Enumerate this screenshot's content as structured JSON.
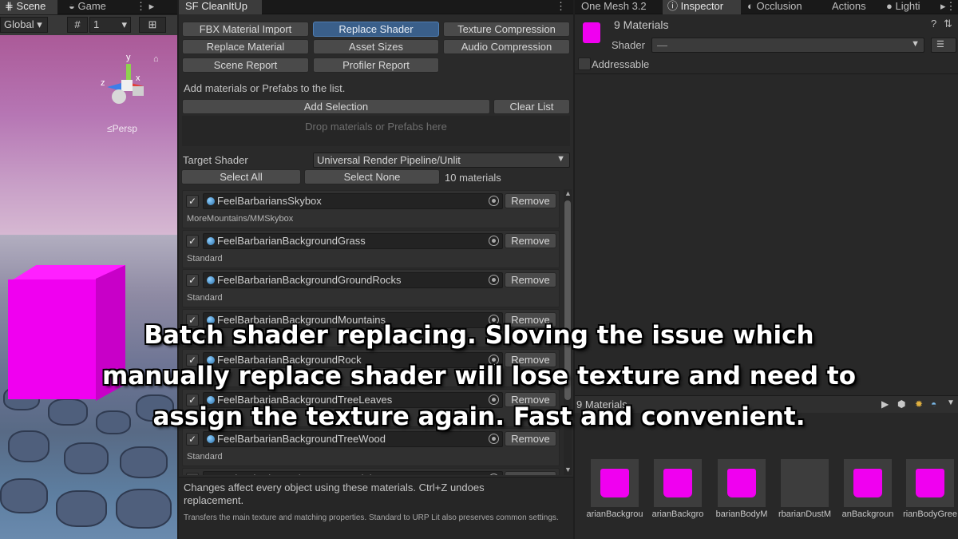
{
  "scene_panel": {
    "tabs": [
      "Scene",
      "Game"
    ],
    "toolbar": {
      "global_label": "Global",
      "grid_value": "1"
    },
    "gizmo": {
      "x": "x",
      "y": "y",
      "z": "z",
      "view_label": "Persp"
    }
  },
  "cleanup_panel": {
    "tab_title": "SF CleanItUp",
    "tools": [
      "FBX Material Import",
      "Replace Shader",
      "Texture Compression",
      "Replace Material",
      "Asset Sizes",
      "Audio Compression",
      "Scene Report",
      "Profiler Report"
    ],
    "active_tool": "Replace Shader",
    "instruction": "Add materials or Prefabs to the list.",
    "add_selection_label": "Add Selection",
    "clear_list_label": "Clear List",
    "drop_hint": "Drop materials or Prefabs here",
    "target_shader_label": "Target Shader",
    "target_shader_value": "Universal Render Pipeline/Unlit",
    "select_all_label": "Select All",
    "select_none_label": "Select None",
    "material_count": "10 materials",
    "remove_label": "Remove",
    "materials": [
      {
        "name": "FeelBarbariansSkybox",
        "shader": "MoreMountains/MMSkybox",
        "checked": true
      },
      {
        "name": "FeelBarbarianBackgroundGrass",
        "shader": "Standard",
        "checked": true
      },
      {
        "name": "FeelBarbarianBackgroundGroundRocks",
        "shader": "Standard",
        "checked": true
      },
      {
        "name": "FeelBarbarianBackgroundMountains",
        "shader": "",
        "checked": true
      },
      {
        "name": "FeelBarbarianBackgroundRock",
        "shader": "",
        "checked": true
      },
      {
        "name": "FeelBarbarianBackgroundTreeLeaves",
        "shader": "",
        "checked": true
      },
      {
        "name": "FeelBarbarianBackgroundTreeWood",
        "shader": "Standard",
        "checked": true
      },
      {
        "name": "FeelBarbarianBodyGreenMaterial",
        "shader": "",
        "checked": true
      }
    ],
    "footer_note": "Changes affect every object using these materials. Ctrl+Z undoes replacement.",
    "footer_detail": "Transfers the main texture and matching properties. Standard to URP Lit also preserves common settings."
  },
  "inspector_panel": {
    "tabs": [
      "One Mesh 3.2",
      "Inspector",
      "Occlusion",
      "Actions",
      "Lighti"
    ],
    "header_title": "9 Materials",
    "shader_label": "Shader",
    "shader_value": "—",
    "addressable_label": "Addressable",
    "preview_title": "9 Materials",
    "thumbnails": [
      {
        "name": "arianBackgrou",
        "magenta": true
      },
      {
        "name": "arianBackgro",
        "magenta": true
      },
      {
        "name": "barianBodyM",
        "magenta": true
      },
      {
        "name": "rbarianDustM",
        "magenta": false
      },
      {
        "name": "anBackgroun",
        "magenta": true
      },
      {
        "name": "rianBodyGree",
        "magenta": true
      }
    ]
  },
  "caption": {
    "line1": "Batch shader replacing. Sloving the issue which",
    "line2": "manually replace shader will lose texture and need to",
    "line3": "assign the texture again. Fast and convenient."
  },
  "colors": {
    "accent": "#3a5f8a",
    "magenta": "#f000f0",
    "panel": "#2a2a2a"
  }
}
